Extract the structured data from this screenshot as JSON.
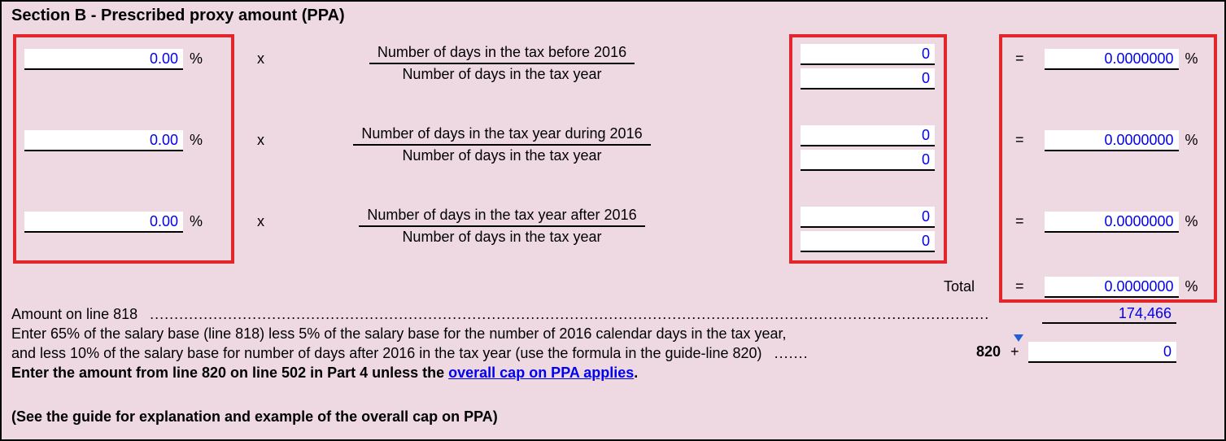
{
  "section_title": "Section B - Prescribed proxy amount (PPA)",
  "symbols": {
    "percent": "%",
    "times": "x",
    "equals": "=",
    "plus": "+"
  },
  "rows": [
    {
      "pct": "0.00",
      "num_label": "Number of days in the tax before 2016",
      "den_label": "Number of days in the tax year",
      "num_val": "0",
      "den_val": "0",
      "result": "0.0000000"
    },
    {
      "pct": "0.00",
      "num_label": "Number of days in the tax year during 2016",
      "den_label": "Number of days in the tax year",
      "num_val": "0",
      "den_val": "0",
      "result": "0.0000000"
    },
    {
      "pct": "0.00",
      "num_label": "Number of days in the tax year after 2016",
      "den_label": "Number of days in the tax year",
      "num_val": "0",
      "den_val": "0",
      "result": "0.0000000"
    }
  ],
  "total": {
    "label": "Total",
    "value": "0.0000000"
  },
  "line818": {
    "label": "Amount on line 818",
    "value": "174,466"
  },
  "instruction": {
    "text1": "Enter 65% of the salary base (line 818) less 5% of the salary base for the number of 2016 calendar days in the tax year,",
    "text2": "and less 10% of the salary base for number of days after 2016 in the tax year (use the formula in the guide-line 820)",
    "dots": ".......",
    "line_no": "820",
    "value": "0"
  },
  "final_instruction": {
    "prefix": "Enter the amount from line 820 on line 502 in Part 4 unless the ",
    "link": "overall cap on PPA applies",
    "suffix": "."
  },
  "guide_note": "(See the guide for explanation and example of the overall cap on PPA)",
  "dots818": "........................................................................................................................................................................................................"
}
